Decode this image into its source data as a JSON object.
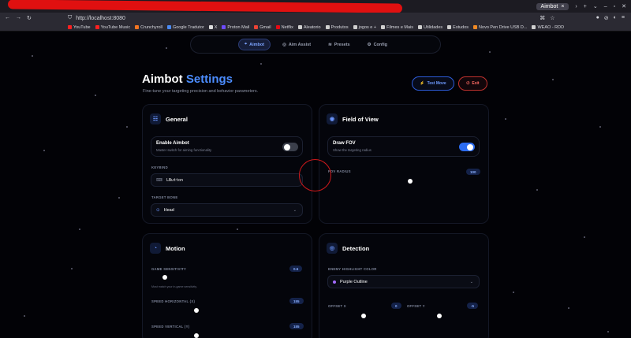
{
  "browser": {
    "active_tab": "Aimbot",
    "tab_close": "×",
    "url": "http://localhost:8080",
    "bookmarks": [
      {
        "label": "YouTube",
        "color": "#ff2020"
      },
      {
        "label": "YouTube Music",
        "color": "#ff2020"
      },
      {
        "label": "Crunchyroll",
        "color": "#f47521"
      },
      {
        "label": "Google Tradutor",
        "color": "#4a8af4"
      },
      {
        "label": "X",
        "color": "#dddddd"
      },
      {
        "label": "Proton Mail",
        "color": "#6d4aff"
      },
      {
        "label": "Gmail",
        "color": "#ea4335"
      },
      {
        "label": "Netflix",
        "color": "#e50914"
      },
      {
        "label": "Aleatorio",
        "color": "#cfcfcf"
      },
      {
        "label": "Produtos",
        "color": "#cfcfcf"
      },
      {
        "label": "jogos e +",
        "color": "#cfcfcf"
      },
      {
        "label": "Filmes e Mais",
        "color": "#cfcfcf"
      },
      {
        "label": "Utilidades",
        "color": "#cfcfcf"
      },
      {
        "label": "Estudos",
        "color": "#cfcfcf"
      },
      {
        "label": "Novo Pen Drive USB D...",
        "color": "#f08a24"
      },
      {
        "label": "WEAO - RDD",
        "color": "#cfcfcf"
      }
    ]
  },
  "nav": {
    "tabs": [
      {
        "label": "Aimbot",
        "icon": "crosshair-icon",
        "active": true
      },
      {
        "label": "Aim Assist",
        "icon": "target-icon",
        "active": false
      },
      {
        "label": "Presets",
        "icon": "layers-icon",
        "active": false
      },
      {
        "label": "Config",
        "icon": "gear-icon",
        "active": false
      }
    ]
  },
  "header": {
    "title_main": "Aimbot",
    "title_accent": "Settings",
    "subtitle": "Fine-tune your targeting precision and behavior parameters.",
    "test_move_label": "Test Move",
    "exit_label": "Exit"
  },
  "general": {
    "title": "General",
    "enable_label": "Enable Aimbot",
    "enable_desc": "Master switch for aiming functionality",
    "enabled": false,
    "keybind_label": "KEYBIND",
    "keybind_value": "LButton",
    "target_bone_label": "TARGET BONE",
    "target_bone_value": "Head"
  },
  "fov": {
    "title": "Field of View",
    "draw_label": "Draw FOV",
    "draw_desc": "Show the targeting radius",
    "draw_enabled": true,
    "radius_label": "FOV RADIUS",
    "radius_value": "100"
  },
  "motion": {
    "title": "Motion",
    "sensitivity_label": "GAME SENSITIVITY",
    "sensitivity_value": "0.5",
    "sensitivity_hint": "Must match your in-game sensitivity.",
    "speed_h_label": "SPEED HORIZONTAL (X)",
    "speed_h_value": "155",
    "speed_v_label": "SPEED VERTICAL (Y)",
    "speed_v_value": "155"
  },
  "detection": {
    "title": "Detection",
    "color_label": "ENEMY HIGHLIGHT COLOR",
    "color_value": "Purple Outline",
    "offset_x_label": "OFFSET X",
    "offset_x_value": "0",
    "offset_y_label": "OFFSET Y",
    "offset_y_value": "-5"
  },
  "colors": {
    "accent": "#4c8dff",
    "danger": "#ff6b64",
    "background": "#020206"
  }
}
